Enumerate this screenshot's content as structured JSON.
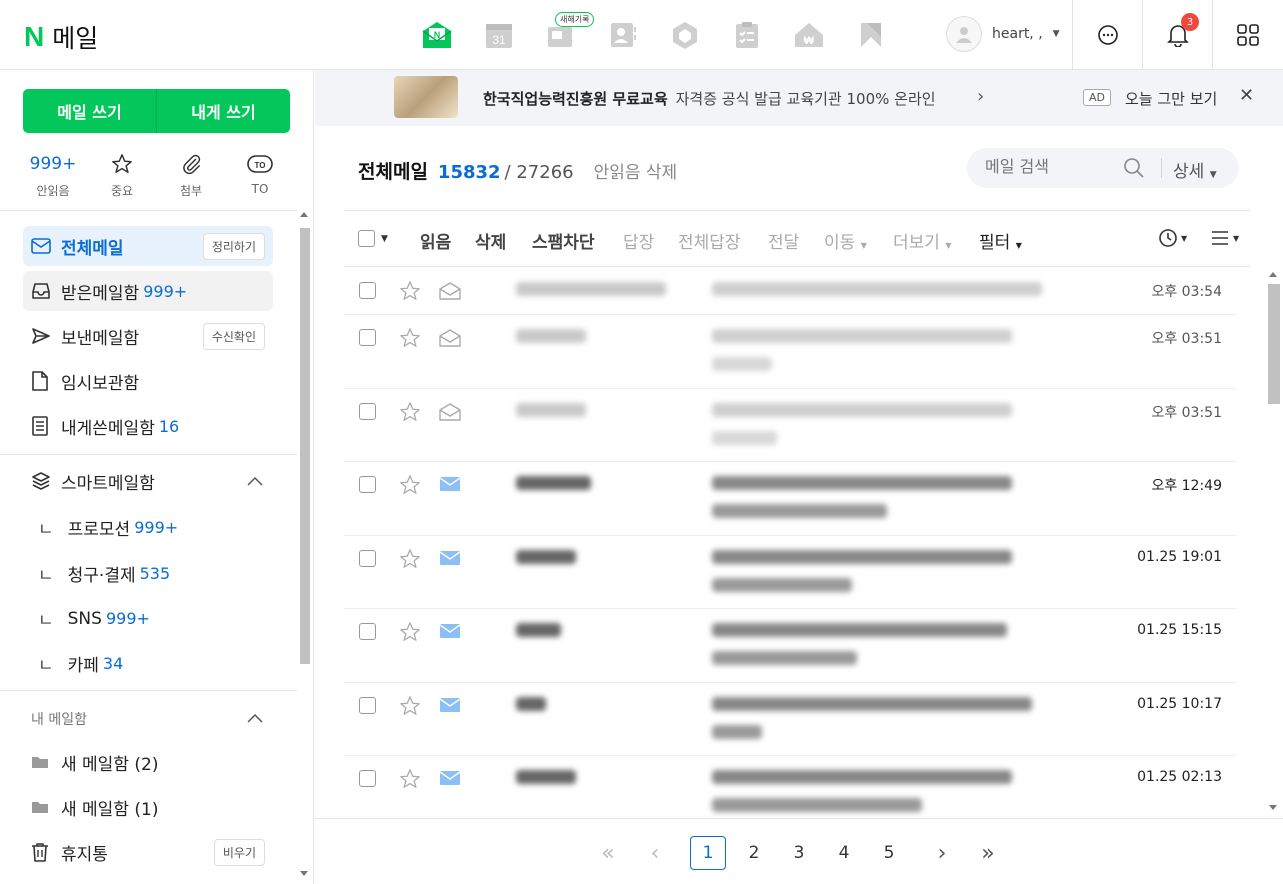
{
  "header": {
    "logo_letter": "N",
    "logo_text": "메일",
    "new_badge": "새해기록",
    "calendar_day": "31",
    "username": "heart, ,",
    "notification_count": "3"
  },
  "sidebar": {
    "write_mail": "메일 쓰기",
    "write_self": "내게 쓰기",
    "quick": [
      {
        "top": "999+",
        "label": "안읽음"
      },
      {
        "top": "",
        "label": "중요"
      },
      {
        "top": "",
        "label": "첨부"
      },
      {
        "top": "",
        "label": "TO"
      }
    ],
    "folders": [
      {
        "label": "전체메일",
        "count": "",
        "pill": "정리하기"
      },
      {
        "label": "받은메일함",
        "count": "999+",
        "pill": ""
      },
      {
        "label": "보낸메일함",
        "count": "",
        "pill": "수신확인"
      },
      {
        "label": "임시보관함",
        "count": "",
        "pill": ""
      },
      {
        "label": "내게쓴메일함",
        "count": "16",
        "pill": ""
      }
    ],
    "smart": {
      "label": "스마트메일함"
    },
    "smart_items": [
      {
        "label": "프로모션",
        "count": "999+"
      },
      {
        "label": "청구·결제",
        "count": "535"
      },
      {
        "label": "SNS",
        "count": "999+"
      },
      {
        "label": "카페",
        "count": "34"
      }
    ],
    "my_section": "내 메일함",
    "my_items": [
      {
        "label": "새 메일함 (2)"
      },
      {
        "label": "새 메일함 (1)"
      }
    ],
    "trash": {
      "label": "휴지통",
      "pill": "비우기"
    }
  },
  "ad": {
    "bold": "한국직업능력진흥원 무료교육",
    "text": "자격증 공식 발급 교육기관 100% 온라인",
    "tag": "AD",
    "hide": "오늘 그만 보기"
  },
  "main": {
    "title": "전체메일",
    "unread": "15832",
    "total": "/ 27266",
    "delete_unread": "안읽음 삭제",
    "search_placeholder": "메일 검색",
    "detail": "상세"
  },
  "toolbar": {
    "read": "읽음",
    "delete": "삭제",
    "spam": "스팸차단",
    "reply": "답장",
    "reply_all": "전체답장",
    "forward": "전달",
    "move": "이동",
    "more": "더보기",
    "filter": "필터"
  },
  "mails": [
    {
      "time": "오후 03:54",
      "unread": false
    },
    {
      "time": "오후 03:51",
      "unread": false
    },
    {
      "time": "오후 03:51",
      "unread": false
    },
    {
      "time": "오후 12:49",
      "unread": true
    },
    {
      "time": "01.25 19:01",
      "unread": true
    },
    {
      "time": "01.25 15:15",
      "unread": true
    },
    {
      "time": "01.25 10:17",
      "unread": true
    },
    {
      "time": "01.25 02:13",
      "unread": true
    }
  ],
  "pager": {
    "pages": [
      "1",
      "2",
      "3",
      "4",
      "5"
    ],
    "current": "1"
  },
  "colors": {
    "brand": "#03c75a",
    "accent": "#0a6cd6",
    "badge": "#f0483e"
  }
}
